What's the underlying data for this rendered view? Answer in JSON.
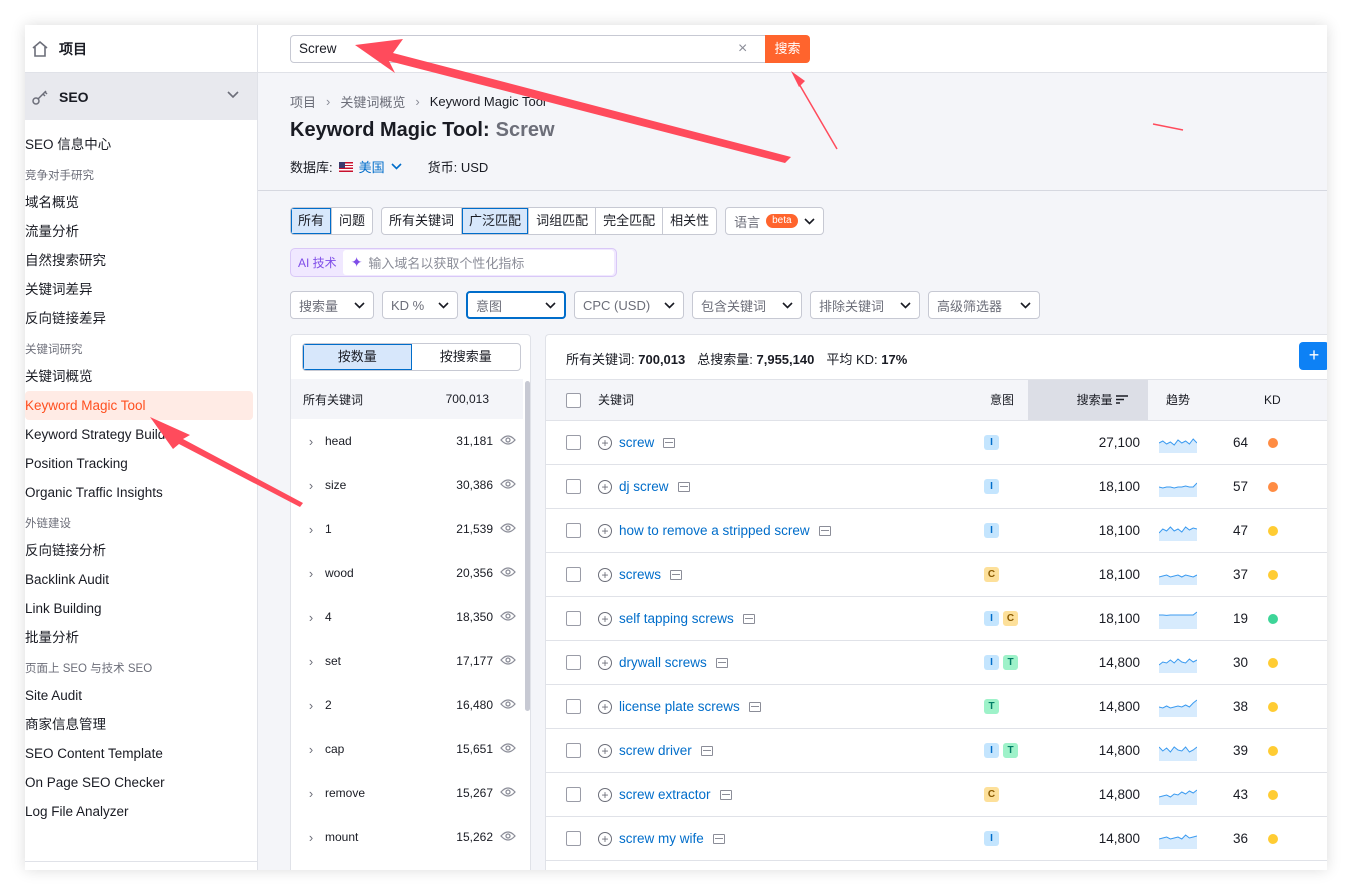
{
  "sidebar": {
    "projects_label": "项目",
    "seo_label": "SEO",
    "items": [
      {
        "type": "item",
        "label": "SEO 信息中心"
      },
      {
        "type": "section",
        "label": "竞争对手研究"
      },
      {
        "type": "item",
        "label": "域名概览"
      },
      {
        "type": "item",
        "label": "流量分析"
      },
      {
        "type": "item",
        "label": "自然搜索研究"
      },
      {
        "type": "item",
        "label": "关键词差异"
      },
      {
        "type": "item",
        "label": "反向链接差异"
      },
      {
        "type": "section",
        "label": "关键词研究"
      },
      {
        "type": "item",
        "label": "关键词概览"
      },
      {
        "type": "item",
        "label": "Keyword Magic Tool",
        "active": true
      },
      {
        "type": "item",
        "label": "Keyword Strategy Builder"
      },
      {
        "type": "item",
        "label": "Position Tracking"
      },
      {
        "type": "item",
        "label": "Organic Traffic Insights"
      },
      {
        "type": "section",
        "label": "外链建设"
      },
      {
        "type": "item",
        "label": "反向链接分析"
      },
      {
        "type": "item",
        "label": "Backlink Audit"
      },
      {
        "type": "item",
        "label": "Link Building"
      },
      {
        "type": "item",
        "label": "批量分析"
      },
      {
        "type": "section",
        "label": "页面上 SEO 与技术 SEO"
      },
      {
        "type": "item",
        "label": "Site Audit"
      },
      {
        "type": "item",
        "label": "商家信息管理"
      },
      {
        "type": "item",
        "label": "SEO Content Template"
      },
      {
        "type": "item",
        "label": "On Page SEO Checker"
      },
      {
        "type": "item",
        "label": "Log File Analyzer"
      }
    ]
  },
  "search": {
    "value": "Screw",
    "button": "搜索",
    "clear": "×"
  },
  "breadcrumb": {
    "items": [
      "项目",
      "关键词概览",
      "Keyword Magic Tool"
    ],
    "sep": "›"
  },
  "title": {
    "tool": "Keyword Magic Tool:",
    "query": "Screw"
  },
  "db": {
    "label": "数据库:",
    "country": "美国",
    "currency": "货币: USD"
  },
  "tabs": {
    "group1": [
      "所有",
      "问题"
    ],
    "group2": [
      "所有关键词",
      "广泛匹配",
      "词组匹配",
      "完全匹配",
      "相关性"
    ],
    "active1": "所有",
    "active2": "广泛匹配",
    "lang": "语言",
    "beta": "beta"
  },
  "ai": {
    "label": "AI 技术",
    "placeholder": "输入域名以获取个性化指标"
  },
  "filters": [
    "搜索量",
    "KD %",
    "意图",
    "CPC (USD)",
    "包含关键词",
    "排除关键词",
    "高级筛选器"
  ],
  "groups": {
    "toggle": [
      "按数量",
      "按搜索量"
    ],
    "header": {
      "label": "所有关键词",
      "count": "700,013"
    },
    "rows": [
      {
        "kw": "head",
        "n": "31,181"
      },
      {
        "kw": "size",
        "n": "30,386"
      },
      {
        "kw": "1",
        "n": "21,539"
      },
      {
        "kw": "wood",
        "n": "20,356"
      },
      {
        "kw": "4",
        "n": "18,350"
      },
      {
        "kw": "set",
        "n": "17,177"
      },
      {
        "kw": "2",
        "n": "16,480"
      },
      {
        "kw": "cap",
        "n": "15,651"
      },
      {
        "kw": "remove",
        "n": "15,267"
      },
      {
        "kw": "mount",
        "n": "15,262"
      }
    ]
  },
  "summary": {
    "all_label": "所有关键词:",
    "all": "700,013",
    "vol_label": "总搜索量:",
    "vol": "7,955,140",
    "kd_label": "平均 KD:",
    "kd": "17%"
  },
  "table": {
    "headers": {
      "keyword": "关键词",
      "intent": "意图",
      "volume": "搜索量",
      "trend": "趋势",
      "kd": "KD"
    },
    "rows": [
      {
        "kw": "screw",
        "intent": [
          "I"
        ],
        "vol": "27,100",
        "kd": "64",
        "kd_color": "#ff8c43",
        "trend": [
          0.5,
          0.4,
          0.55,
          0.45,
          0.6,
          0.35,
          0.5,
          0.4,
          0.55,
          0.3,
          0.5
        ]
      },
      {
        "kw": "dj screw",
        "intent": [
          "I"
        ],
        "vol": "18,100",
        "kd": "57",
        "kd_color": "#ff8c43",
        "trend": [
          0.5,
          0.55,
          0.5,
          0.5,
          0.55,
          0.5,
          0.5,
          0.45,
          0.5,
          0.5,
          0.3
        ]
      },
      {
        "kw": "how to remove a stripped screw",
        "intent": [
          "I"
        ],
        "vol": "18,100",
        "kd": "47",
        "kd_color": "#ffcc33",
        "trend": [
          0.6,
          0.4,
          0.5,
          0.3,
          0.5,
          0.4,
          0.55,
          0.3,
          0.45,
          0.35,
          0.4
        ]
      },
      {
        "kw": "screws",
        "intent": [
          "C"
        ],
        "vol": "18,100",
        "kd": "37",
        "kd_color": "#ffcc33",
        "trend": [
          0.6,
          0.55,
          0.5,
          0.6,
          0.55,
          0.5,
          0.6,
          0.5,
          0.55,
          0.6,
          0.5
        ]
      },
      {
        "kw": "self tapping screws",
        "intent": [
          "I",
          "C"
        ],
        "vol": "18,100",
        "kd": "19",
        "kd_color": "#3dd598",
        "trend": [
          0.3,
          0.3,
          0.32,
          0.3,
          0.3,
          0.3,
          0.3,
          0.3,
          0.3,
          0.3,
          0.15
        ]
      },
      {
        "kw": "drywall screws",
        "intent": [
          "I",
          "T"
        ],
        "vol": "14,800",
        "kd": "30",
        "kd_color": "#ffcc33",
        "trend": [
          0.6,
          0.45,
          0.5,
          0.35,
          0.5,
          0.3,
          0.45,
          0.5,
          0.3,
          0.45,
          0.35
        ]
      },
      {
        "kw": "license plate screws",
        "intent": [
          "T"
        ],
        "vol": "14,800",
        "kd": "38",
        "kd_color": "#ffcc33",
        "trend": [
          0.5,
          0.55,
          0.45,
          0.55,
          0.5,
          0.45,
          0.5,
          0.4,
          0.5,
          0.3,
          0.15
        ]
      },
      {
        "kw": "screw driver",
        "intent": [
          "I",
          "T"
        ],
        "vol": "14,800",
        "kd": "39",
        "kd_color": "#ffcc33",
        "trend": [
          0.3,
          0.5,
          0.35,
          0.55,
          0.3,
          0.45,
          0.5,
          0.3,
          0.55,
          0.45,
          0.3
        ]
      },
      {
        "kw": "screw extractor",
        "intent": [
          "C"
        ],
        "vol": "14,800",
        "kd": "43",
        "kd_color": "#ffcc33",
        "trend": [
          0.6,
          0.55,
          0.5,
          0.6,
          0.45,
          0.5,
          0.35,
          0.45,
          0.3,
          0.4,
          0.25
        ]
      },
      {
        "kw": "screw my wife",
        "intent": [
          "I"
        ],
        "vol": "14,800",
        "kd": "36",
        "kd_color": "#ffcc33",
        "trend": [
          0.5,
          0.45,
          0.4,
          0.5,
          0.45,
          0.4,
          0.5,
          0.3,
          0.45,
          0.4,
          0.35
        ]
      }
    ]
  },
  "colors": {
    "accent": "#ff642d",
    "link": "#006dca",
    "annotation": "#ff4b5c"
  }
}
